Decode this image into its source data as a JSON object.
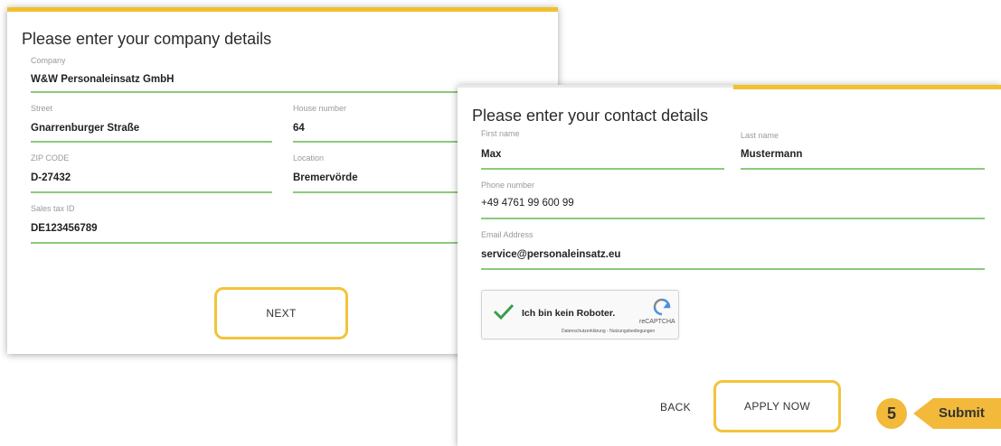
{
  "company_form": {
    "title": "Please enter your company details",
    "company": {
      "label": "Company",
      "value": "W&W Personaleinsatz GmbH"
    },
    "street": {
      "label": "Street",
      "value": "Gnarrenburger Straße"
    },
    "house_number": {
      "label": "House number",
      "value": "64"
    },
    "zip": {
      "label": "ZIP CODE",
      "value": "D-27432"
    },
    "location": {
      "label": "Location",
      "value": "Bremervörde"
    },
    "sales_tax_id": {
      "label": "Sales tax ID",
      "value": "DE123456789"
    },
    "next_label": "NEXT"
  },
  "contact_form": {
    "title": "Please enter your contact details",
    "first_name": {
      "label": "First name",
      "value": "Max"
    },
    "last_name": {
      "label": "Last name",
      "value": "Mustermann"
    },
    "phone": {
      "label": "Phone number",
      "value": "+49 4761 99 600 99"
    },
    "email": {
      "label": "Email Address",
      "value": "service@personaleinsatz.eu"
    },
    "recaptcha": {
      "label": "Ich bin kein Roboter.",
      "brand": "reCAPTCHA",
      "links": "Datenschutzerklärung - Nutzungsbedingungen",
      "icon": "recaptcha-logo-icon"
    },
    "back_label": "BACK",
    "apply_label": "APPLY NOW"
  },
  "callout": {
    "number": "5",
    "text": "Submit"
  },
  "colors": {
    "accent_yellow": "#f2c12e",
    "field_underline": "#8cc97b",
    "highlight_border": "#f3c33b",
    "check_green": "#3a9d4a"
  }
}
